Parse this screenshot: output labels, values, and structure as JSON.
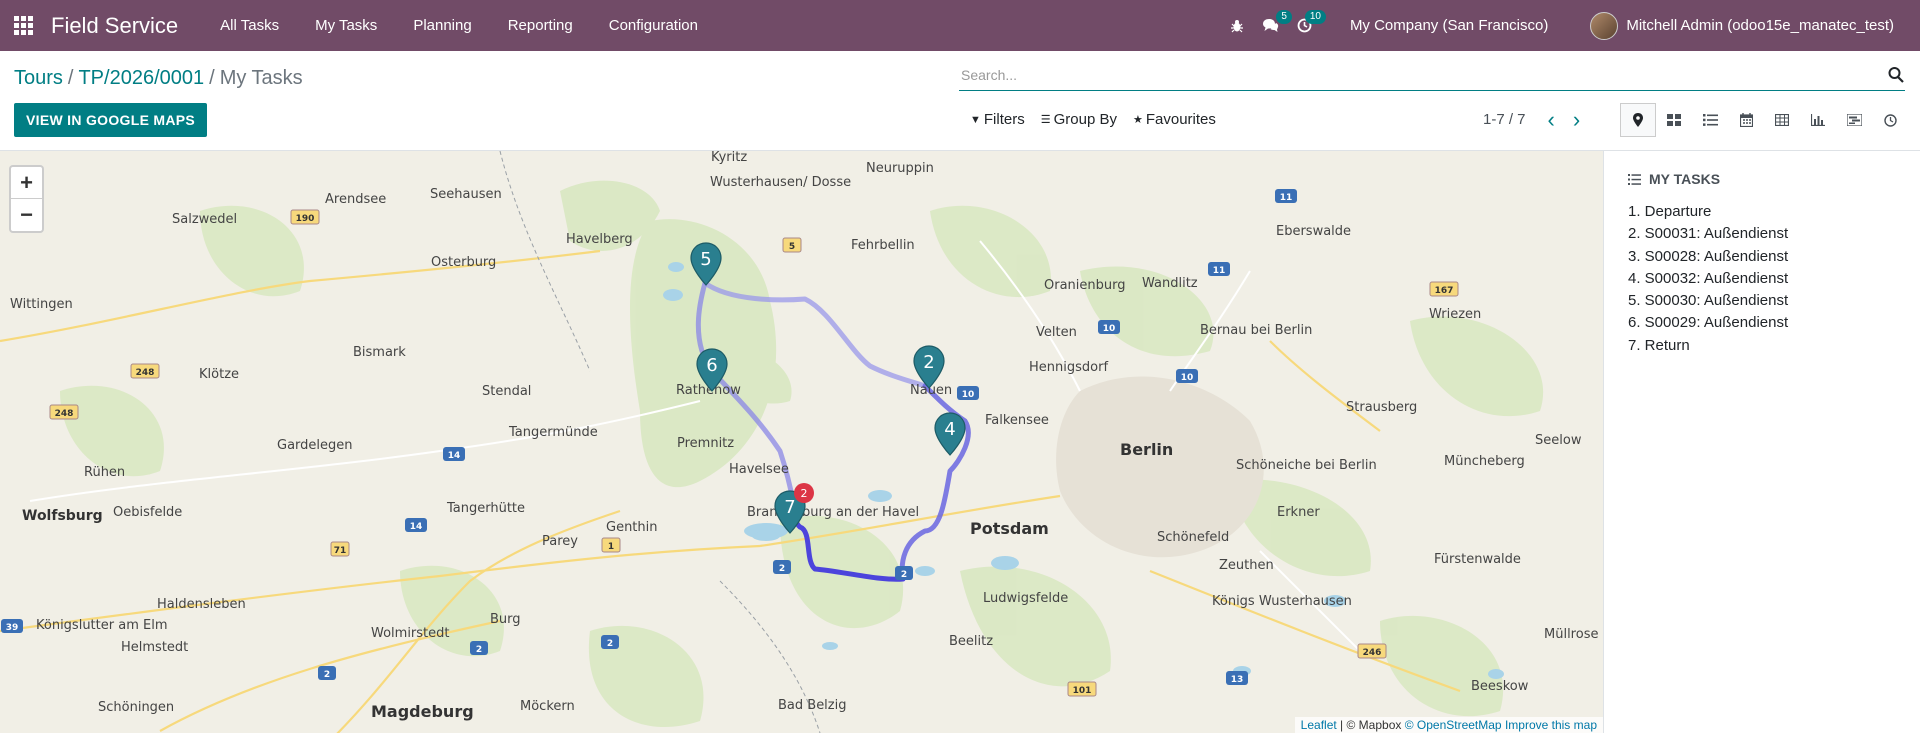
{
  "navbar": {
    "brand": "Field Service",
    "menu": [
      "All Tasks",
      "My Tasks",
      "Planning",
      "Reporting",
      "Configuration"
    ],
    "messages_badge": "5",
    "activities_badge": "10",
    "company": "My Company (San Francisco)",
    "user": "Mitchell Admin (odoo15e_manatec_test)",
    "accent_color": "#714B67"
  },
  "breadcrumb": {
    "items": [
      "Tours",
      "TP/2026/0001"
    ],
    "current": "My Tasks"
  },
  "control": {
    "google_maps_button": "VIEW IN GOOGLE MAPS",
    "search_placeholder": "Search...",
    "filters_label": "Filters",
    "group_by_label": "Group By",
    "favourites_label": "Favourites",
    "pager": "1-7 / 7",
    "views": [
      "map-icon",
      "kanban-icon",
      "list-icon",
      "calendar-icon",
      "pivot-icon",
      "graph-icon",
      "gantt-icon",
      "activity-icon"
    ],
    "primary_color": "#017e84"
  },
  "map": {
    "zoom_in": "+",
    "zoom_out": "−",
    "markers": [
      {
        "label": "5"
      },
      {
        "label": "6"
      },
      {
        "label": "2"
      },
      {
        "label": "4"
      },
      {
        "label": "7",
        "cluster_count": "2"
      }
    ],
    "cities": [
      "Salzwedel",
      "Arendsee",
      "Seehausen",
      "Havelberg",
      "Kyritz",
      "Wusterhausen/ Dosse",
      "Neuruppin",
      "Fehrbellin",
      "Eberswalde",
      "Osterburg",
      "Oranienburg",
      "Wandlitz",
      "Wittingen",
      "Bismark",
      "Velten",
      "Hennigsdorf",
      "Bernau bei Berlin",
      "Wriezen",
      "Klötze",
      "Stendal",
      "Rathenow",
      "Nauen",
      "Falkensee",
      "Berlin",
      "Strausberg",
      "Gardelegen",
      "Tangermünde",
      "Premnitz",
      "Seelow",
      "Rühen",
      "Havelsee",
      "Schöneiche bei Berlin",
      "Müncheberg",
      "Wolfsburg",
      "Oebisfelde",
      "Tangerhütte",
      "Brandenburg an der Havel",
      "Potsdam",
      "Erkner",
      "Genthin",
      "Parey",
      "Schönefeld",
      "Zeuthen",
      "Fürstenwalde",
      "Haldensleben",
      "Burg",
      "Ludwigsfelde",
      "Königs Wusterhausen",
      "Königslutter am Elm",
      "Helmstedt",
      "Wolmirstedt",
      "Beelitz",
      "Müllrose",
      "Schöningen",
      "Magdeburg",
      "Möckern",
      "Bad Belzig",
      "Beeskow"
    ],
    "attribution": {
      "leaflet": "Leaflet",
      "mapbox": "© Mapbox",
      "osm": "© OpenStreetMap",
      "improve": "Improve this map"
    }
  },
  "side_panel": {
    "title": "MY TASKS",
    "items": [
      "1. Departure",
      "2. S00031: Außendienst",
      "3. S00028: Außendienst",
      "4. S00032: Außendienst",
      "5. S00030: Außendienst",
      "6. S00029: Außendienst",
      "7. Return"
    ]
  }
}
